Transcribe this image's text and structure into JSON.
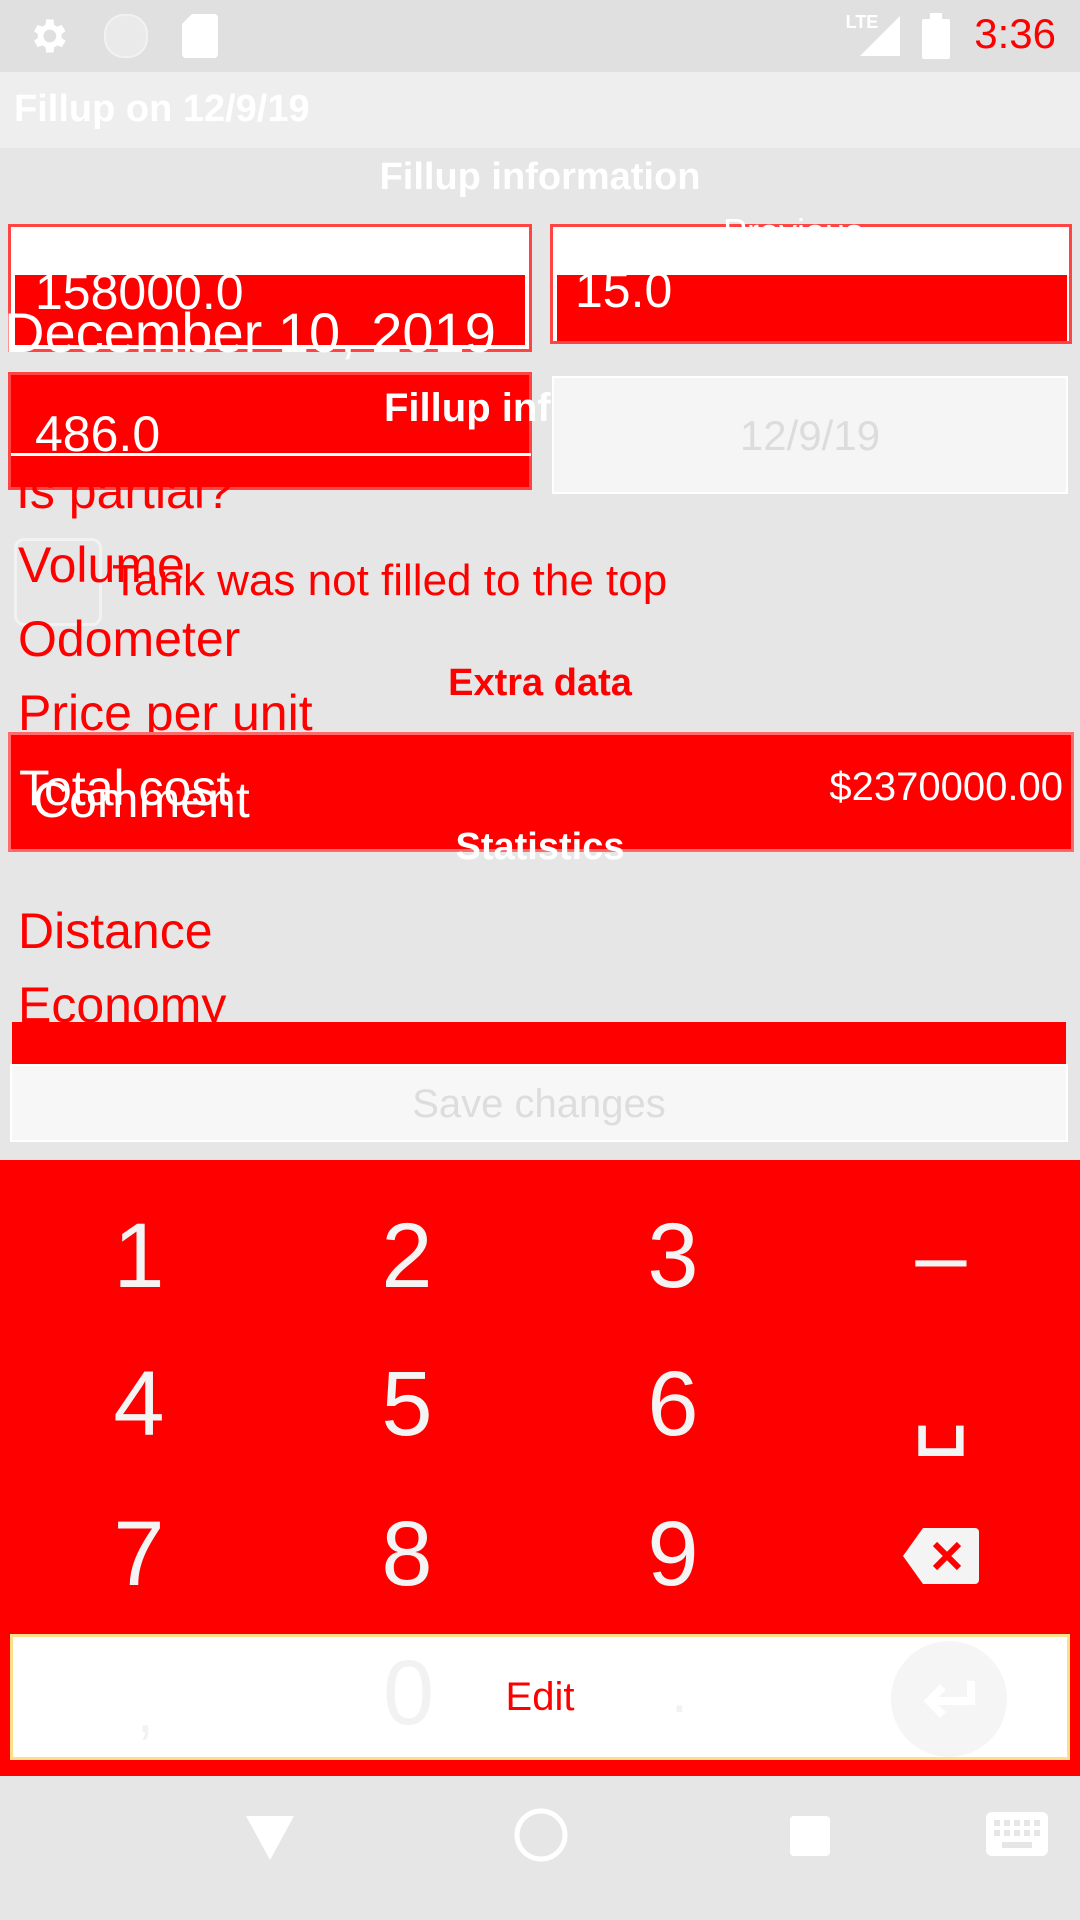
{
  "status_bar": {
    "network": "LTE",
    "time": "3:36",
    "icons": [
      "gear-icon",
      "circle-icon",
      "sd-card-icon",
      "signal-icon",
      "battery-icon"
    ]
  },
  "app": {
    "title": "Fillup on 12/9/19"
  },
  "sections": {
    "fillup_info": "Fillup information",
    "fillup_info_overlap": "Fillup inf",
    "extra_data": "Extra data",
    "statistics": "Statistics"
  },
  "fields": {
    "odometer_value": "158000.0",
    "previous_value": "15.0",
    "volume_value": "486.0",
    "date_display": "December 10, 2019",
    "date_button": "12/9/19",
    "total_cost_value": "$2370000.00"
  },
  "labels": {
    "is_partial": "Is partial?",
    "partial_hint": "Tank was not filled to the top",
    "volume": "Volume",
    "odometer": "Odometer",
    "price_per_unit": "Price per unit",
    "total_cost": "Total cost",
    "comment": "Comment",
    "distance": "Distance",
    "economy": "Economy",
    "previous": "Previous"
  },
  "buttons": {
    "save": "Save changes"
  },
  "keyboard": {
    "rows": [
      [
        "1",
        "2",
        "3",
        "–"
      ],
      [
        "4",
        "5",
        "6",
        "␣"
      ],
      [
        "7",
        "8",
        "9",
        "⌫"
      ]
    ],
    "bottom": {
      "comma": ",",
      "zero": "0",
      "dot": "."
    },
    "edit_label": "Edit"
  },
  "colors": {
    "accent": "#ff0000",
    "background": "#e6e6e6"
  }
}
